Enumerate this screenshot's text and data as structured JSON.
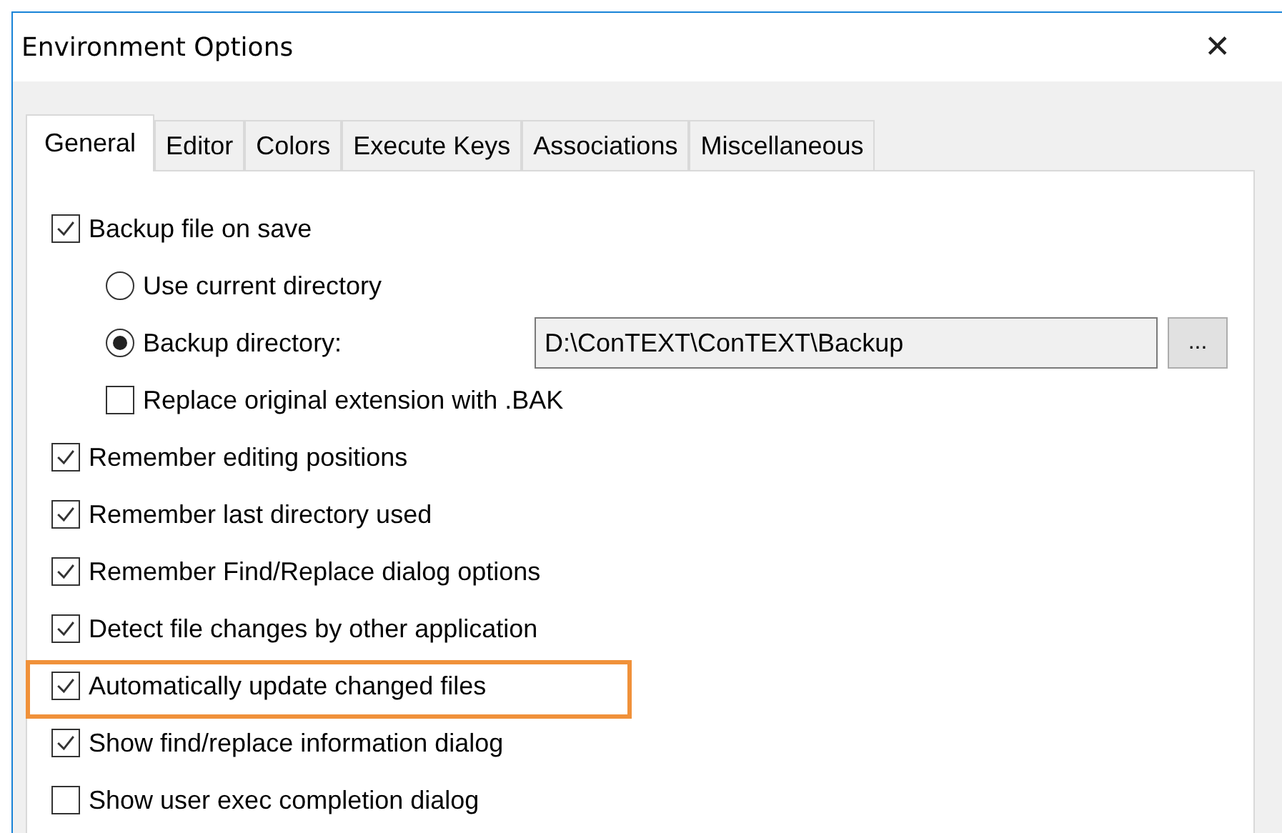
{
  "window": {
    "title": "Environment Options",
    "close": "✕"
  },
  "tabs": [
    {
      "label": "General",
      "selected": true
    },
    {
      "label": "Editor",
      "selected": false
    },
    {
      "label": "Colors",
      "selected": false
    },
    {
      "label": "Execute Keys",
      "selected": false
    },
    {
      "label": "Associations",
      "selected": false
    },
    {
      "label": "Miscellaneous",
      "selected": false
    }
  ],
  "options": [
    {
      "kind": "checkbox",
      "label": "Backup file on save",
      "checked": true,
      "highlighted": false,
      "children": [
        {
          "kind": "radio",
          "label": "Use current directory",
          "selected": false,
          "highlighted": false
        },
        {
          "kind": "radio",
          "label": "Backup directory:",
          "selected": true,
          "highlighted": false,
          "path_field": {
            "value": "D:\\ConTEXT\\ConTEXT\\Backup"
          },
          "browse_button": "..."
        },
        {
          "kind": "checkbox",
          "label": "Replace original extension with .BAK",
          "checked": false,
          "highlighted": false
        }
      ]
    },
    {
      "kind": "checkbox",
      "label": "Remember editing positions",
      "checked": true,
      "highlighted": false
    },
    {
      "kind": "checkbox",
      "label": "Remember last directory used",
      "checked": true,
      "highlighted": false
    },
    {
      "kind": "checkbox",
      "label": "Remember Find/Replace dialog options",
      "checked": true,
      "highlighted": false
    },
    {
      "kind": "checkbox",
      "label": "Detect file changes by other application",
      "checked": true,
      "highlighted": false
    },
    {
      "kind": "checkbox",
      "label": "Automatically update changed files",
      "checked": true,
      "highlighted": true
    },
    {
      "kind": "checkbox",
      "label": "Show find/replace information dialog",
      "checked": true,
      "highlighted": false
    },
    {
      "kind": "checkbox",
      "label": "Show user exec completion dialog",
      "checked": false,
      "highlighted": false
    }
  ]
}
